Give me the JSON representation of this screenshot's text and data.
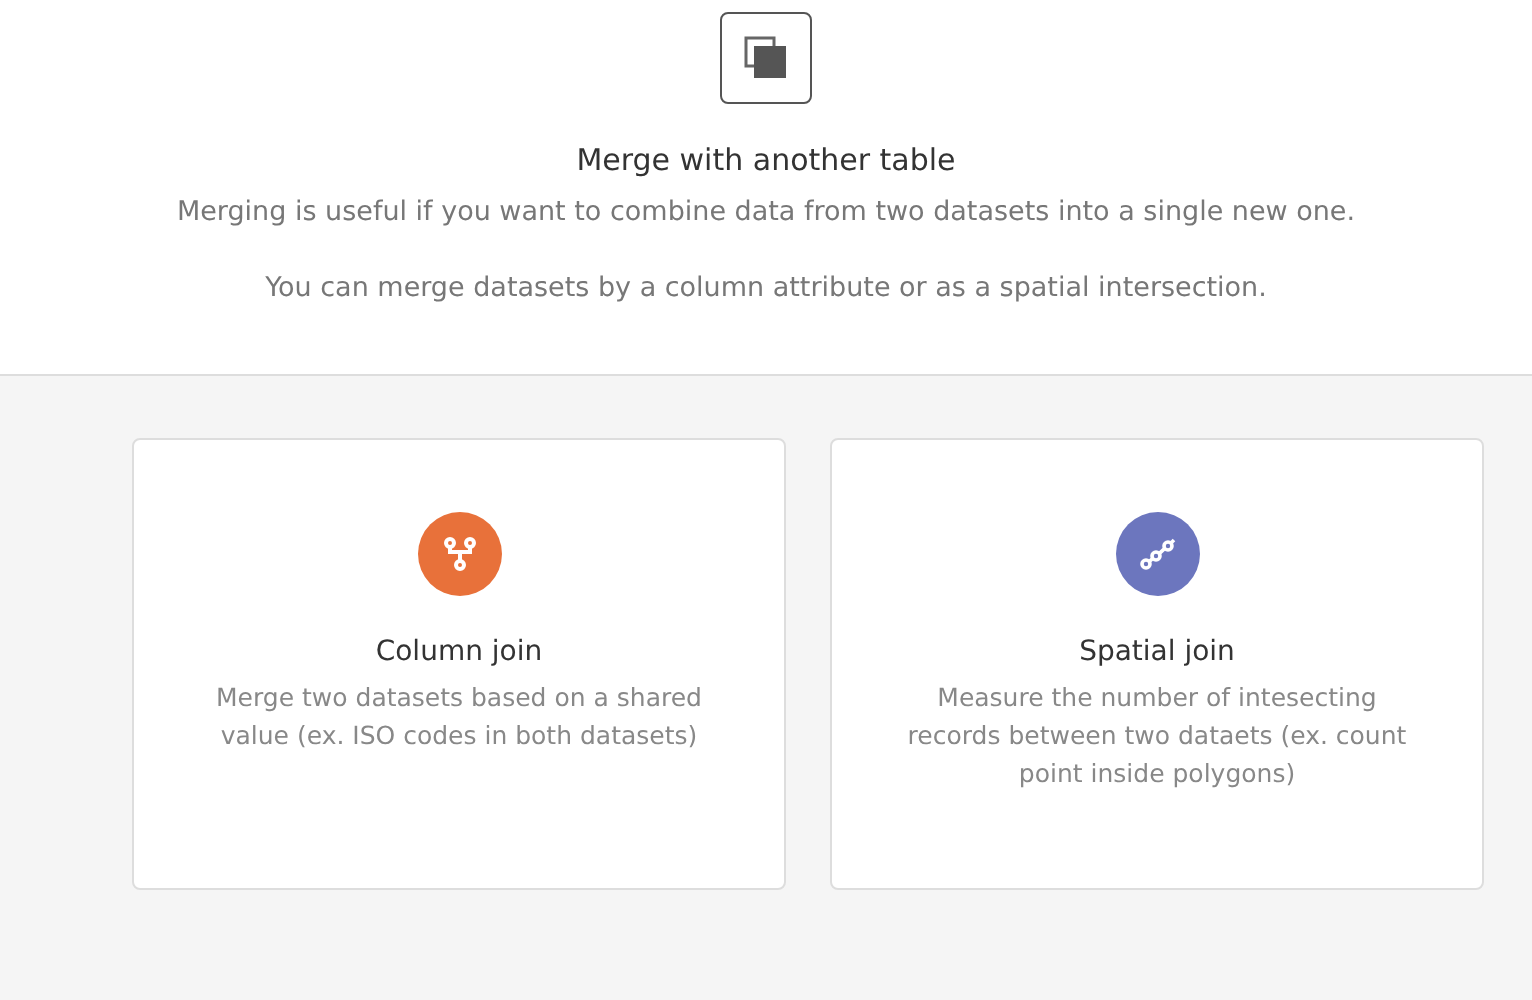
{
  "header": {
    "title": "Merge with another table",
    "description": "Merging is useful if you want to combine data from two datasets into a single new one.",
    "note": "You can merge datasets by a column attribute or as a spatial intersection."
  },
  "options": [
    {
      "kind": "column",
      "color": "#e8713a",
      "title": "Column join",
      "description": "Merge two datasets based on a shared value (ex. ISO codes in both datasets)"
    },
    {
      "kind": "spatial",
      "color": "#6c76be",
      "title": "Spatial join",
      "description": "Measure the number of intesecting records between two dataets (ex. count point inside polygons)"
    }
  ]
}
